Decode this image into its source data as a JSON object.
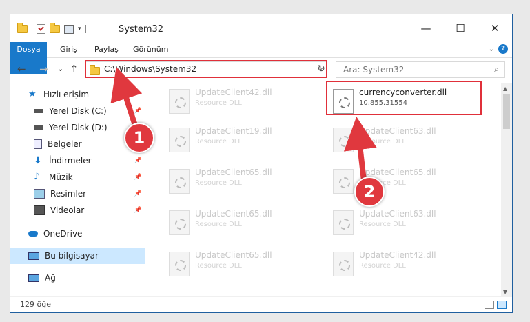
{
  "window": {
    "title": "System32"
  },
  "window_buttons": {
    "minimize": "—",
    "maximize": "☐",
    "close": "✕"
  },
  "ribbon": {
    "tabs": [
      "Dosya",
      "Giriş",
      "Paylaş",
      "Görünüm"
    ]
  },
  "nav": {
    "back": "←",
    "forward": "→",
    "recent": "⌄",
    "up": "↑",
    "address": "C:\\Windows\\System32",
    "refresh": "↻",
    "search_placeholder": "Ara: System32"
  },
  "sidebar": {
    "items": [
      {
        "label": "Hızlı erişim",
        "icon": "star-icon",
        "pinned": false
      },
      {
        "label": "Yerel Disk (C:)",
        "icon": "drive-icon",
        "pinned": true
      },
      {
        "label": "Yerel Disk (D:)",
        "icon": "drive-icon",
        "pinned": true
      },
      {
        "label": "Belgeler",
        "icon": "documents-icon",
        "pinned": true
      },
      {
        "label": "İndirmeler",
        "icon": "download-icon",
        "pinned": true
      },
      {
        "label": "Müzik",
        "icon": "music-icon",
        "pinned": true
      },
      {
        "label": "Resimler",
        "icon": "pictures-icon",
        "pinned": true
      },
      {
        "label": "Videolar",
        "icon": "videos-icon",
        "pinned": true
      },
      {
        "label": "OneDrive",
        "icon": "cloud-icon",
        "pinned": false
      },
      {
        "label": "Bu bilgisayar",
        "icon": "computer-icon",
        "pinned": false,
        "selected": true
      },
      {
        "label": "Ağ",
        "icon": "network-icon",
        "pinned": false
      }
    ],
    "pin_glyph": "📌"
  },
  "files": [
    {
      "name": "UpdateClient42.dll",
      "sub": "Resource DLL",
      "active": false
    },
    {
      "name": "currencyconverter.dll",
      "sub": "10.855.31554",
      "active": true
    },
    {
      "name": "UpdateClient19.dll",
      "sub": "Resource DLL",
      "active": false
    },
    {
      "name": "UpdateClient63.dll",
      "sub": "Resource DLL",
      "active": false
    },
    {
      "name": "UpdateClient65.dll",
      "sub": "Resource DLL",
      "active": false
    },
    {
      "name": "UpdateClient65.dll",
      "sub": "Resource DLL",
      "active": false
    },
    {
      "name": "UpdateClient65.dll",
      "sub": "Resource DLL",
      "active": false
    },
    {
      "name": "UpdateClient63.dll",
      "sub": "Resource DLL",
      "active": false
    },
    {
      "name": "UpdateClient65.dll",
      "sub": "Resource DLL",
      "active": false
    },
    {
      "name": "UpdateClient42.dll",
      "sub": "Resource DLL",
      "active": false
    }
  ],
  "status": {
    "item_count": "129 öğe"
  },
  "annotations": {
    "step1": "1",
    "step2": "2",
    "color": "#e0383e"
  }
}
